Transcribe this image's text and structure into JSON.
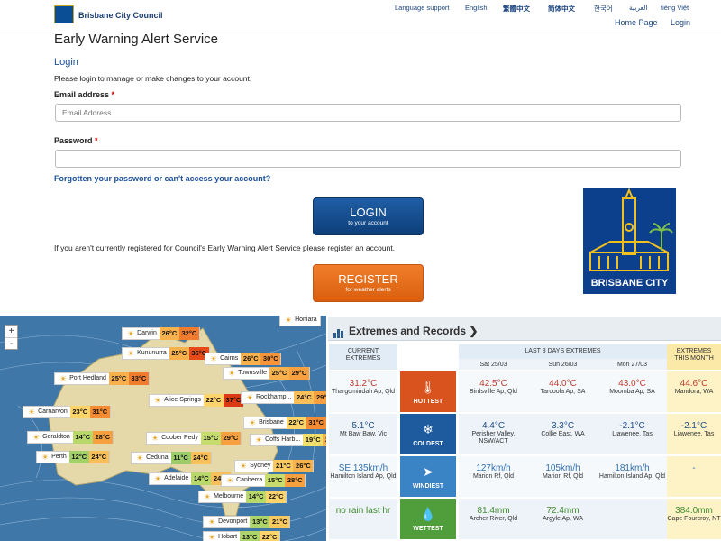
{
  "header": {
    "org_name": "Brisbane City Council",
    "languages": [
      "Language support",
      "English",
      "繁體中文",
      "简体中文",
      "한국어",
      "العربية",
      "tiếng Việt"
    ],
    "nav": [
      "Home Page",
      "Login"
    ]
  },
  "form": {
    "page_title": "Early Warning Alert Service",
    "section_title": "Login",
    "intro": "Please login to manage or make changes to your account.",
    "email_label": "Email address",
    "email_placeholder": "Email Address",
    "password_label": "Password",
    "required_mark": "*",
    "forgot_link": "Forgotten your password or can't access your account?",
    "login_label": "LOGIN",
    "login_sub": "to your account",
    "register_note": "If you aren't currently registered for Council's Early Warning Alert Service please register an account.",
    "register_label": "REGISTER",
    "register_sub": "for weather alerts",
    "logo_text": "BRISBANE CITY"
  },
  "map": {
    "zoom_in": "+",
    "zoom_out": "-",
    "cities": [
      {
        "name": "Darwin",
        "min": "26°C",
        "max": "32°C",
        "minc": "#f7b14d",
        "maxc": "#f27c2e"
      },
      {
        "name": "Kununurra",
        "min": "25°C",
        "max": "36°C",
        "minc": "#f7b14d",
        "maxc": "#e64a19"
      },
      {
        "name": "Cairns",
        "min": "26°C",
        "max": "30°C",
        "minc": "#f7b14d",
        "maxc": "#f7943a"
      },
      {
        "name": "Townsville",
        "min": "25°C",
        "max": "29°C",
        "minc": "#f7b14d",
        "maxc": "#f7a040"
      },
      {
        "name": "Port Hedland",
        "min": "25°C",
        "max": "33°C",
        "minc": "#f7b14d",
        "maxc": "#f27c2e"
      },
      {
        "name": "Alice Springs",
        "min": "22°C",
        "max": "37°C",
        "minc": "#fcd46b",
        "maxc": "#d93a14"
      },
      {
        "name": "Rockhamp...",
        "min": "24°C",
        "max": "29°C",
        "minc": "#f9c05a",
        "maxc": "#f7a040"
      },
      {
        "name": "Carnarvon",
        "min": "23°C",
        "max": "31°C",
        "minc": "#fcd46b",
        "maxc": "#f58c34"
      },
      {
        "name": "Brisbane",
        "min": "22°C",
        "max": "31°C",
        "minc": "#fcd46b",
        "maxc": "#f58c34"
      },
      {
        "name": "Geraldton",
        "min": "14°C",
        "max": "28°C",
        "minc": "#b8d86b",
        "maxc": "#f7a040"
      },
      {
        "name": "Coober Pedy",
        "min": "15°C",
        "max": "29°C",
        "minc": "#c6dc6c",
        "maxc": "#f7a040"
      },
      {
        "name": "Coffs Harb...",
        "min": "19°C",
        "max": "27°C",
        "minc": "#f0de6d",
        "maxc": "#f7ad48"
      },
      {
        "name": "Perth",
        "min": "12°C",
        "max": "24°C",
        "minc": "#a4d06a",
        "maxc": "#f9c05a"
      },
      {
        "name": "Ceduna",
        "min": "11°C",
        "max": "24°C",
        "minc": "#9ccc6a",
        "maxc": "#f9c05a"
      },
      {
        "name": "Sydney",
        "min": "21°C",
        "max": "26°C",
        "minc": "#f9c85f",
        "maxc": "#f7b14d"
      },
      {
        "name": "Adelaide",
        "min": "14°C",
        "max": "24°C",
        "minc": "#b8d86b",
        "maxc": "#f9c05a"
      },
      {
        "name": "Canberra",
        "min": "15°C",
        "max": "28°C",
        "minc": "#c6dc6c",
        "maxc": "#f7a040"
      },
      {
        "name": "Melbourne",
        "min": "14°C",
        "max": "22°C",
        "minc": "#b8d86b",
        "maxc": "#fcd46b"
      },
      {
        "name": "Devonport",
        "min": "13°C",
        "max": "21°C",
        "minc": "#acd46b",
        "maxc": "#f9c85f"
      },
      {
        "name": "Hobart",
        "min": "13°C",
        "max": "22°C",
        "minc": "#acd46b",
        "maxc": "#fcd46b"
      },
      {
        "name": "Honiara",
        "min": "",
        "max": "",
        "minc": "",
        "maxc": ""
      }
    ]
  },
  "extremes": {
    "title": "Extremes and Records",
    "current_header": "CURRENT EXTREMES",
    "last3_header": "LAST 3 DAYS EXTREMES",
    "month_header": "EXTREMES THIS MONTH",
    "days": [
      "Sat 25/03",
      "Sun 26/03",
      "Mon 27/03"
    ],
    "rows": [
      {
        "label": "HOTTEST",
        "color": "#d9531e",
        "current_val": "31.2°C",
        "current_loc": "Thargomindah Ap, Qld",
        "d1": "42.5°C",
        "d1l": "Birdsville Ap, Qld",
        "d2": "44.0°C",
        "d2l": "Tarcoola Ap, SA",
        "d3": "43.0°C",
        "d3l": "Moomba Ap, SA",
        "m": "44.6°C",
        "ml": "Mandora, WA",
        "valcolor": "#c0392b"
      },
      {
        "label": "COLDEST",
        "color": "#1d5a9e",
        "current_val": "5.1°C",
        "current_loc": "Mt Baw Baw, Vic",
        "d1": "4.4°C",
        "d1l": "Perisher Valley, NSW/ACT",
        "d2": "3.3°C",
        "d2l": "Collie East, WA",
        "d3": "-2.1°C",
        "d3l": "Liawenee, Tas",
        "m": "-2.1°C",
        "ml": "Liawenee, Tas",
        "valcolor": "#1d4f8c"
      },
      {
        "label": "WINDIEST",
        "color": "#3a83c4",
        "current_val": "SE 135km/h",
        "current_loc": "Hamilton Island Ap, Qld",
        "d1": "127km/h",
        "d1l": "Marion Rf, Qld",
        "d2": "105km/h",
        "d2l": "Marion Rf, Qld",
        "d3": "181km/h",
        "d3l": "Hamilton Island Ap, Qld",
        "m": "-",
        "ml": "",
        "valcolor": "#2f6fad"
      },
      {
        "label": "WETTEST",
        "color": "#4f9e3b",
        "current_val": "no rain last hr",
        "current_loc": "",
        "d1": "81.4mm",
        "d1l": "Archer River, Qld",
        "d2": "72.4mm",
        "d2l": "Argyle Ap, WA",
        "d3": "",
        "d3l": "",
        "m": "384.0mm",
        "ml": "Cape Fourcroy, NT",
        "valcolor": "#3f8a2e"
      }
    ]
  }
}
